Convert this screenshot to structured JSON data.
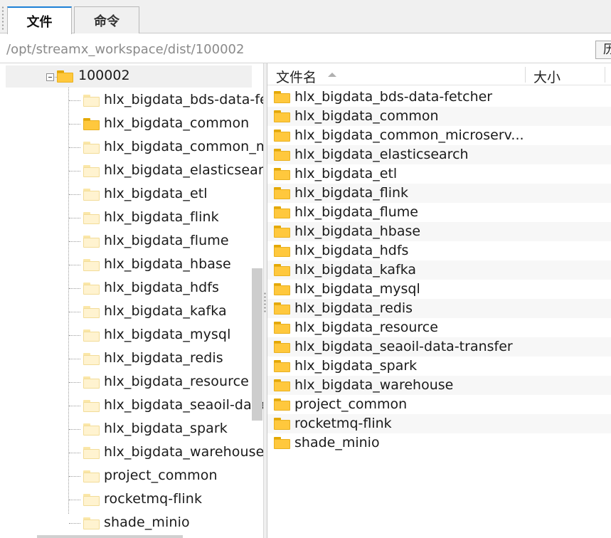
{
  "tabs": {
    "files": "文件",
    "commands": "命令"
  },
  "path": {
    "value": "/opt/streamx_workspace/dist/100002",
    "button_label": "历"
  },
  "tree": {
    "root": "100002",
    "items": [
      "hlx_bigdata_bds-data-fetcher",
      "hlx_bigdata_common",
      "hlx_bigdata_common_microservice",
      "hlx_bigdata_elasticsearch",
      "hlx_bigdata_etl",
      "hlx_bigdata_flink",
      "hlx_bigdata_flume",
      "hlx_bigdata_hbase",
      "hlx_bigdata_hdfs",
      "hlx_bigdata_kafka",
      "hlx_bigdata_mysql",
      "hlx_bigdata_redis",
      "hlx_bigdata_resource",
      "hlx_bigdata_seaoil-data-transfer",
      "hlx_bigdata_spark",
      "hlx_bigdata_warehouse",
      "project_common",
      "rocketmq-flink",
      "shade_minio"
    ]
  },
  "list": {
    "columns": {
      "name": "文件名",
      "size": "大小"
    },
    "rows": [
      "hlx_bigdata_bds-data-fetcher",
      "hlx_bigdata_common",
      "hlx_bigdata_common_microserv...",
      "hlx_bigdata_elasticsearch",
      "hlx_bigdata_etl",
      "hlx_bigdata_flink",
      "hlx_bigdata_flume",
      "hlx_bigdata_hbase",
      "hlx_bigdata_hdfs",
      "hlx_bigdata_kafka",
      "hlx_bigdata_mysql",
      "hlx_bigdata_redis",
      "hlx_bigdata_resource",
      "hlx_bigdata_seaoil-data-transfer",
      "hlx_bigdata_spark",
      "hlx_bigdata_warehouse",
      "project_common",
      "rocketmq-flink",
      "shade_minio"
    ]
  },
  "icons": {
    "folder": "folder-icon",
    "expander": "collapse-minus-icon",
    "sort": "sort-ascending-icon"
  },
  "colors": {
    "accent": "#1d80d6",
    "folder": "#ffc83d",
    "folder_pale": "#fff3d0"
  }
}
